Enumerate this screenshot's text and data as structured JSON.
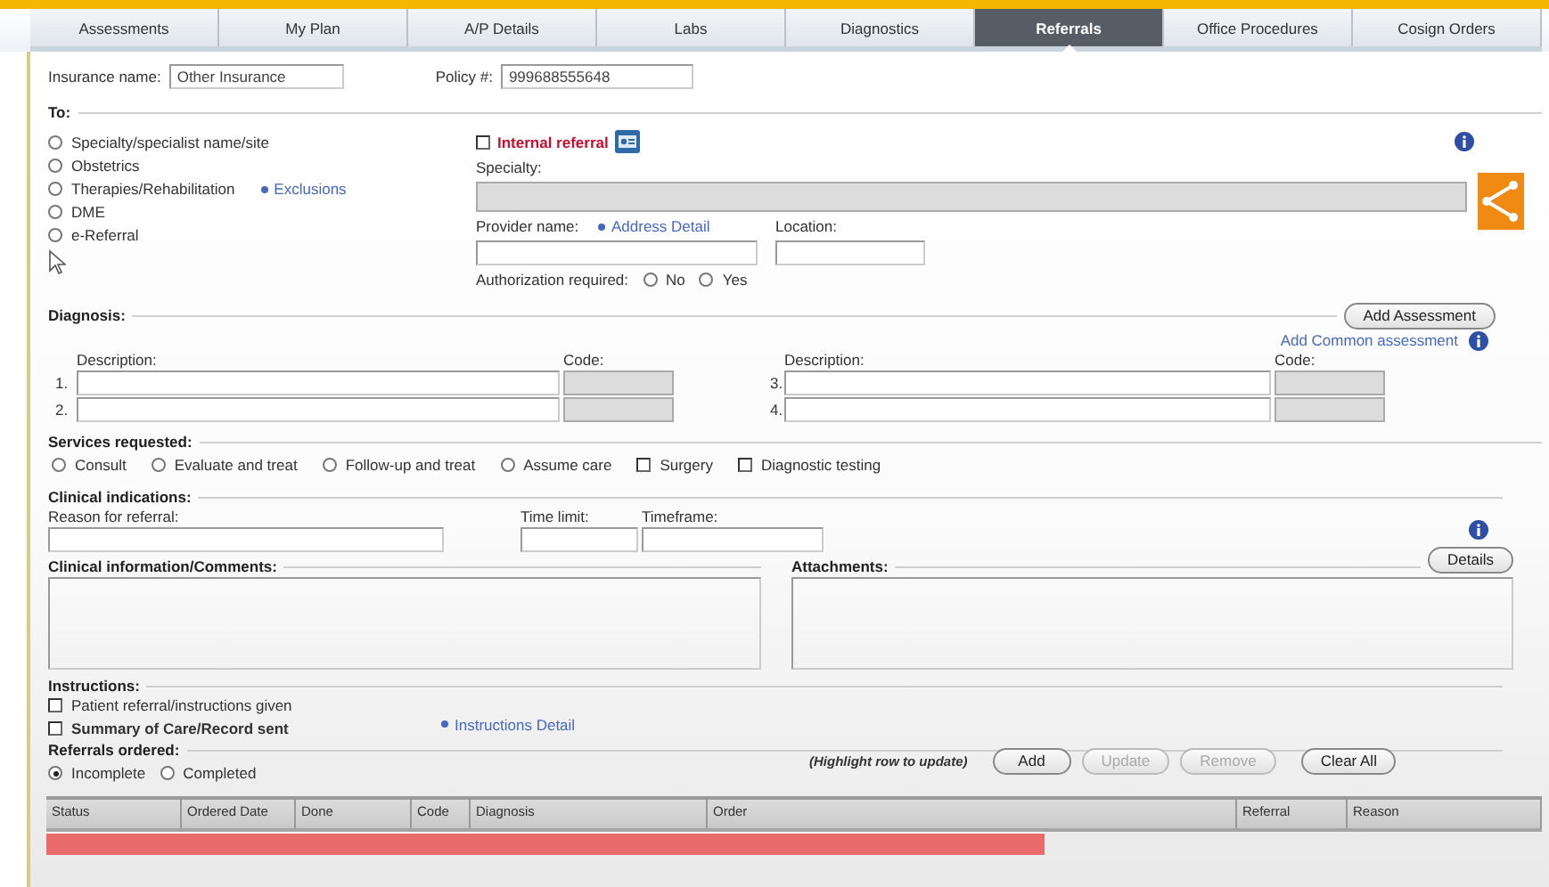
{
  "tabs": [
    {
      "label": "Assessments",
      "selected": false
    },
    {
      "label": "My Plan",
      "selected": false
    },
    {
      "label": "A/P Details",
      "selected": false
    },
    {
      "label": "Labs",
      "selected": false
    },
    {
      "label": "Diagnostics",
      "selected": false
    },
    {
      "label": "Referrals",
      "selected": true
    },
    {
      "label": "Office Procedures",
      "selected": false
    },
    {
      "label": "Cosign Orders",
      "selected": false
    }
  ],
  "insurance": {
    "name_label": "Insurance name:",
    "name_value": "Other Insurance",
    "policy_label": "Policy #:",
    "policy_value": "999688555648"
  },
  "to": {
    "label": "To:",
    "options": [
      {
        "label": "Specialty/specialist name/site",
        "selected": false
      },
      {
        "label": "Obstetrics",
        "selected": false
      },
      {
        "label": "Therapies/Rehabilitation",
        "selected": false,
        "link": "Exclusions"
      },
      {
        "label": "DME",
        "selected": false
      },
      {
        "label": "e-Referral",
        "selected": false
      }
    ]
  },
  "internal_referral": {
    "label": "Internal referral",
    "checked": false
  },
  "specialty": {
    "label": "Specialty:"
  },
  "provider": {
    "label": "Provider name:",
    "link": "Address Detail"
  },
  "location": {
    "label": "Location:"
  },
  "authorization": {
    "label": "Authorization required:",
    "options": [
      {
        "label": "No",
        "selected": false
      },
      {
        "label": "Yes",
        "selected": false
      }
    ]
  },
  "diagnosis": {
    "label": "Diagnosis:",
    "add_button": "Add Assessment",
    "common_link": "Add Common assessment",
    "groups": [
      {
        "description_label": "Description:",
        "code_label": "Code:",
        "rows": [
          "1.",
          "2."
        ]
      },
      {
        "description_label": "Description:",
        "code_label": "Code:",
        "rows": [
          "3.",
          "4."
        ]
      }
    ]
  },
  "services": {
    "label": "Services requested:",
    "options": [
      {
        "kind": "radio",
        "label": "Consult",
        "selected": false
      },
      {
        "kind": "radio",
        "label": "Evaluate and treat",
        "selected": false
      },
      {
        "kind": "radio",
        "label": "Follow-up and treat",
        "selected": false
      },
      {
        "kind": "radio",
        "label": "Assume care",
        "selected": false
      },
      {
        "kind": "checkbox",
        "label": "Surgery",
        "checked": false
      },
      {
        "kind": "checkbox",
        "label": "Diagnostic testing",
        "checked": false
      }
    ]
  },
  "clinical": {
    "label": "Clinical indications:",
    "reason_label": "Reason for referral:",
    "time_limit_label": "Time limit:",
    "timeframe_label": "Timeframe:"
  },
  "comments": {
    "label": "Clinical information/Comments:"
  },
  "attachments": {
    "label": "Attachments:",
    "details_button": "Details"
  },
  "instructions": {
    "label": "Instructions:",
    "options": [
      {
        "label": "Patient referral/instructions given",
        "checked": false,
        "bold": false
      },
      {
        "label": "Summary of Care/Record sent",
        "checked": false,
        "bold": true
      }
    ],
    "link": "Instructions Detail"
  },
  "referrals": {
    "label": "Referrals ordered:",
    "filters": [
      {
        "label": "Incomplete",
        "selected": true
      },
      {
        "label": "Completed",
        "selected": false
      }
    ],
    "hint": "(Highlight row to update)",
    "buttons": [
      {
        "label": "Add",
        "disabled": false
      },
      {
        "label": "Update",
        "disabled": true
      },
      {
        "label": "Remove",
        "disabled": true
      },
      {
        "label": "Clear All",
        "disabled": false
      }
    ]
  },
  "table": {
    "columns": [
      "Status",
      "Ordered Date",
      "Done",
      "Code",
      "Diagnosis",
      "Order",
      "Referral",
      "Reason"
    ],
    "rows": [
      {
        "selected": true
      }
    ]
  }
}
